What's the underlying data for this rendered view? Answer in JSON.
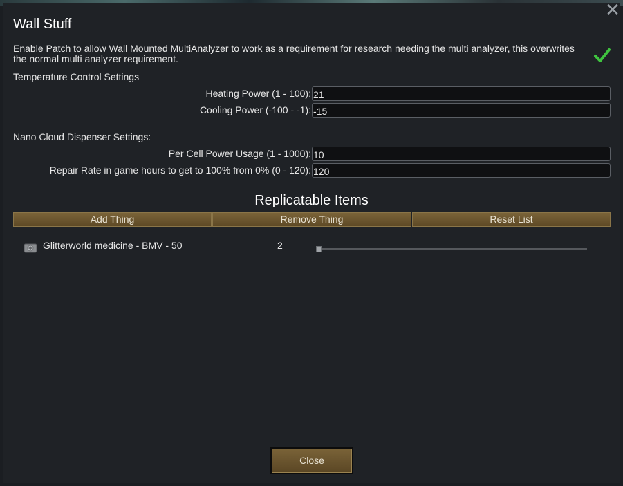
{
  "dialog": {
    "title": "Wall Stuff",
    "close_symbol": "✕"
  },
  "patch": {
    "description": "Enable Patch to allow Wall Mounted MultiAnalyzer to work as a requirement for research needing the multi analyzer, this overwrites the normal multi analyzer requirement.",
    "enabled": true,
    "check_icon": "checkmark-icon",
    "check_color": "#3fc43f"
  },
  "temperature": {
    "heading": "Temperature Control Settings",
    "heating_label": "Heating Power (1 - 100):",
    "heating_value": "21",
    "cooling_label": "Cooling Power (-100 - -1):",
    "cooling_value": "-15"
  },
  "nano": {
    "heading": "Nano Cloud Dispenser Settings:",
    "power_label": "Per Cell Power Usage (1 - 1000):",
    "power_value": "10",
    "repair_label": "Repair Rate in game hours to get to 100% from 0% (0 - 120):",
    "repair_value": "120"
  },
  "replicatable": {
    "heading": "Replicatable Items",
    "add_label": "Add Thing",
    "remove_label": "Remove Thing",
    "reset_label": "Reset List",
    "items": [
      {
        "icon": "medicine-kit-icon",
        "label": "Glitterworld medicine - BMV - 50",
        "count": "2",
        "slider_fraction": 0.0
      }
    ]
  },
  "footer": {
    "close_label": "Close"
  },
  "colors": {
    "accent_button": "#6e5830",
    "panel": "#1f2226",
    "field": "#0f1012"
  }
}
